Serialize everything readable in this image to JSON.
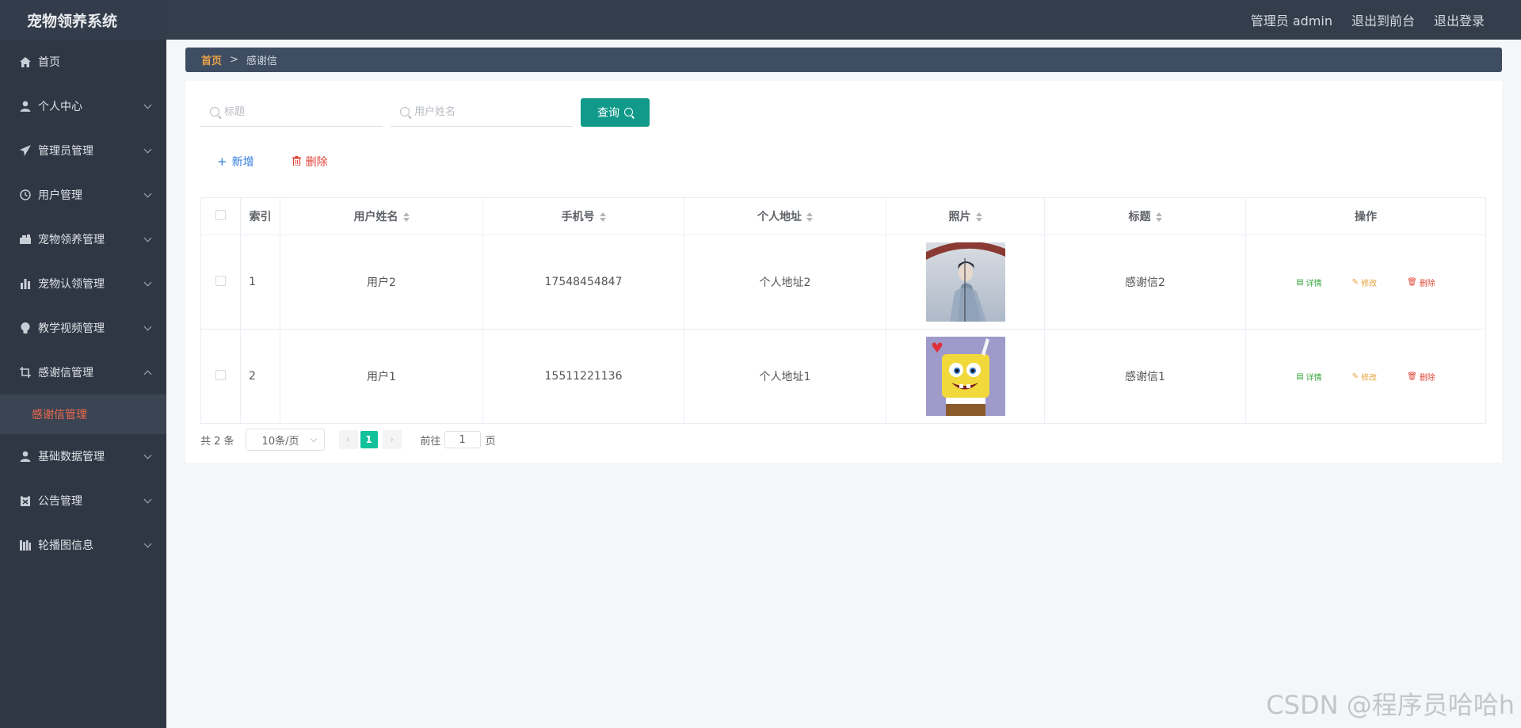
{
  "app": {
    "title": "宠物领养系统"
  },
  "header": {
    "user": "管理员 admin",
    "front": "退出到前台",
    "logout": "退出登录"
  },
  "sidebar": {
    "items": [
      {
        "label": "首页",
        "icon": "home-icon",
        "expandable": false
      },
      {
        "label": "个人中心",
        "icon": "user-icon",
        "expandable": true
      },
      {
        "label": "管理员管理",
        "icon": "paper-plane-icon",
        "expandable": true
      },
      {
        "label": "用户管理",
        "icon": "clock-icon",
        "expandable": true
      },
      {
        "label": "宠物领养管理",
        "icon": "briefcase-icon",
        "expandable": true
      },
      {
        "label": "宠物认领管理",
        "icon": "bar-chart-icon",
        "expandable": true
      },
      {
        "label": "教学视频管理",
        "icon": "bulb-icon",
        "expandable": true
      },
      {
        "label": "感谢信管理",
        "icon": "crop-icon",
        "expandable": true,
        "open": true
      },
      {
        "label": "基础数据管理",
        "icon": "user-icon",
        "expandable": true
      },
      {
        "label": "公告管理",
        "icon": "clipboard-icon",
        "expandable": true
      },
      {
        "label": "轮播图信息",
        "icon": "columns-icon",
        "expandable": true
      }
    ],
    "subitem": "感谢信管理"
  },
  "breadcrumb": {
    "home": "首页",
    "sep": ">",
    "current": "感谢信"
  },
  "search": {
    "title_placeholder": "标题",
    "name_placeholder": "用户姓名",
    "query_label": "查询"
  },
  "actions": {
    "add": "新增",
    "delete": "删除"
  },
  "table": {
    "headers": [
      "索引",
      "用户姓名",
      "手机号",
      "个人地址",
      "照片",
      "标题",
      "操作"
    ],
    "rows": [
      {
        "index": "1",
        "name": "用户2",
        "phone": "17548454847",
        "address": "个人地址2",
        "title": "感谢信2"
      },
      {
        "index": "2",
        "name": "用户1",
        "phone": "15511221136",
        "address": "个人地址1",
        "title": "感谢信1"
      }
    ],
    "ops": {
      "view": "详情",
      "edit": "修改",
      "remove": "删除"
    }
  },
  "pagination": {
    "total": "共 2 条",
    "page_size": "10条/页",
    "current": "1",
    "goto_prefix": "前往",
    "goto_value": "1",
    "goto_suffix": "页"
  },
  "watermark": "CSDN @程序员哈哈h",
  "colors": {
    "header": "#333d4b",
    "sidebar": "#2f3744",
    "accent": "#119a8a",
    "active_sub": "#f06a4f",
    "page_active": "#13c19b"
  }
}
